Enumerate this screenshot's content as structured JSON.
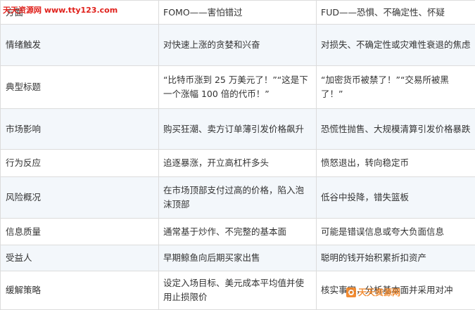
{
  "watermark": {
    "top_site": "天天资源网",
    "top_url": "www.tty123.com",
    "bottom_text": "天天资源网"
  },
  "header": {
    "col1": "方面",
    "col2": "FOMO——害怕错过",
    "col3": "FUD——恐惧、不确定性、怀疑"
  },
  "rows": [
    {
      "aspect": "情绪触发",
      "fomo": "对快速上涨的贪婪和兴奋",
      "fud": "对损失、不确定性或灾难性衰退的焦虑"
    },
    {
      "aspect": "典型标题",
      "fomo": "“比特币涨到 25 万美元了！”“这是下一个涨幅 100 倍的代币！”",
      "fud": "“加密货币被禁了！”“交易所被黑了！”"
    },
    {
      "aspect": "市场影响",
      "fomo": "购买狂潮、卖方订单薄引发价格飙升",
      "fud": "恐慌性抛售、大规模清算引发价格暴跌"
    },
    {
      "aspect": "行为反应",
      "fomo": "追逐暴涨，开立高杠杆多头",
      "fud": "愤怒退出，转向稳定币"
    },
    {
      "aspect": "风险概况",
      "fomo": "在市场顶部支付过高的价格，陷入泡沫顶部",
      "fud": "低谷中投降，错失篮板"
    },
    {
      "aspect": "信息质量",
      "fomo": "通常基于炒作、不完整的基本面",
      "fud": "可能是错误信息或夸大负面信息"
    },
    {
      "aspect": "受益人",
      "fomo": "早期鲸鱼向后期买家出售",
      "fud": "聪明的钱开始积累折扣资产"
    },
    {
      "aspect": "缓解策略",
      "fomo": "设定入场目标、美元成本平均值并使用止损限价",
      "fud": "核实事实，分析基本面并采用对冲"
    }
  ]
}
